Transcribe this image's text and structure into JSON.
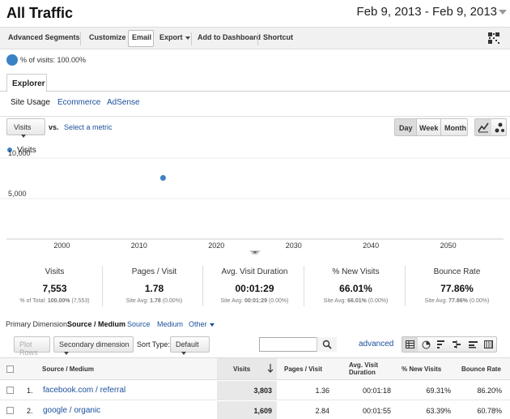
{
  "header": {
    "title": "All Traffic",
    "date_range": "Feb 9, 2013 - Feb 9, 2013"
  },
  "toolbar": {
    "advanced_segments": "Advanced Segments",
    "customize": "Customize",
    "email": "Email",
    "export": "Export",
    "add_to_dashboard": "Add to Dashboard",
    "shortcut": "Shortcut"
  },
  "segment": {
    "label": "% of visits: 100.00%",
    "color": "#3b82c4"
  },
  "tabs": {
    "explorer": "Explorer",
    "subtabs": [
      "Site Usage",
      "Ecommerce",
      "AdSense"
    ]
  },
  "metric_select": {
    "selected": "Visits",
    "vs": "vs.",
    "select_metric": "Select a metric"
  },
  "granularity": [
    "Day",
    "Week",
    "Month"
  ],
  "chart_data": {
    "type": "scatter",
    "series": [
      {
        "name": "Visits",
        "color": "#3b82c4",
        "points": [
          {
            "x": 2013.1,
            "y": 7553
          }
        ]
      }
    ],
    "x_ticks": [
      "2000",
      "2010",
      "2020",
      "2030",
      "2040",
      "2050"
    ],
    "y_ticks": [
      "10,000",
      "5,000"
    ],
    "xlim": [
      1992,
      2058
    ],
    "ylim": [
      0,
      12000
    ]
  },
  "scorecards": [
    {
      "label": "Visits",
      "value": "7,553",
      "sub_prefix": "% of Total: ",
      "sub_bold": "100.00%",
      "sub_suffix": " (7,553)"
    },
    {
      "label": "Pages / Visit",
      "value": "1.78",
      "sub_prefix": "Site Avg: ",
      "sub_bold": "1.78",
      "sub_suffix": " (0.00%)"
    },
    {
      "label": "Avg. Visit Duration",
      "value": "00:01:29",
      "sub_prefix": "Site Avg: ",
      "sub_bold": "00:01:29",
      "sub_suffix": " (0.00%)"
    },
    {
      "label": "% New Visits",
      "value": "66.01%",
      "sub_prefix": "Site Avg: ",
      "sub_bold": "66.01%",
      "sub_suffix": " (0.00%)"
    },
    {
      "label": "Bounce Rate",
      "value": "77.86%",
      "sub_prefix": "Site Avg: ",
      "sub_bold": "77.86%",
      "sub_suffix": " (0.00%)"
    }
  ],
  "primary_dimension": {
    "label": "Primary Dimension:",
    "selected": "Source / Medium",
    "options": [
      "Source",
      "Medium",
      "Other"
    ]
  },
  "controls": {
    "plot_rows": "Plot Rows",
    "secondary_dimension": "Secondary dimension",
    "sort_type_label": "Sort Type:",
    "sort_type_value": "Default",
    "advanced": "advanced"
  },
  "table": {
    "headers": {
      "source_medium": "Source / Medium",
      "visits": "Visits",
      "pages_visit": "Pages / Visit",
      "avg_visit_duration_1": "Avg. Visit",
      "avg_visit_duration_2": "Duration",
      "new_visits": "% New Visits",
      "bounce_rate": "Bounce Rate"
    },
    "rows": [
      {
        "index": "1.",
        "source": "facebook.com / referral",
        "visits": "3,803",
        "pages": "1.36",
        "duration": "00:01:18",
        "new_visits": "69.31%",
        "bounce": "86.20%"
      },
      {
        "index": "2.",
        "source": "google / organic",
        "visits": "1,609",
        "pages": "2.84",
        "duration": "00:01:55",
        "new_visits": "63.39%",
        "bounce": "60.78%"
      }
    ]
  }
}
